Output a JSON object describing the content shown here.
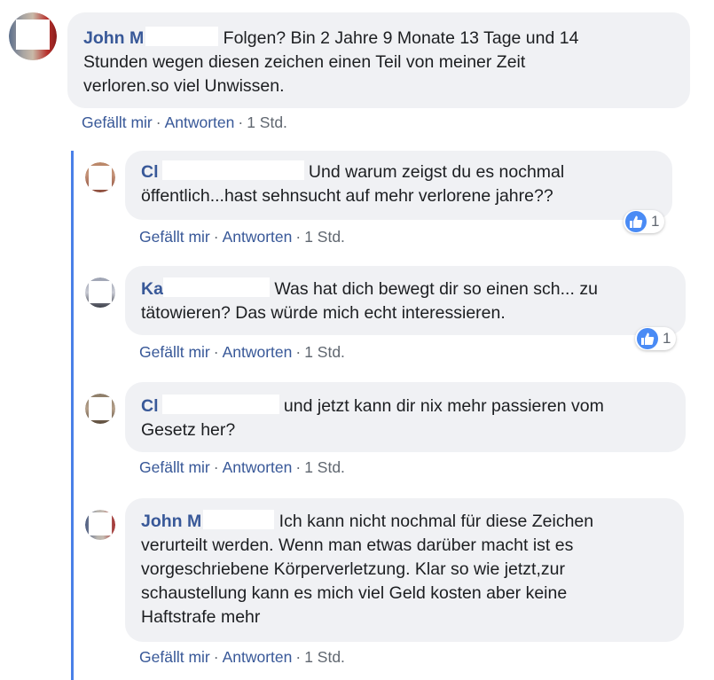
{
  "comments": [
    {
      "author": "John M",
      "text_line1": "Folgen? Bin 2 Jahre 9 Monate 13 Tage und 14",
      "text_lines": [
        "Stunden wegen diesen zeichen einen Teil von meiner Zeit",
        "verloren.so viel Unwissen."
      ],
      "like_label": "Gefällt mir",
      "reply_label": "Antworten",
      "time": "1 Std.",
      "separator": "·"
    }
  ],
  "replies": [
    {
      "author": "Cl",
      "text_line1": "Und warum zeigst du es nochmal",
      "text_lines": [
        "öffentlich...hast sehnsucht auf mehr verlorene jahre??"
      ],
      "like_label": "Gefällt mir",
      "reply_label": "Antworten",
      "time": "1 Std.",
      "reaction": {
        "icon": "like-icon",
        "count": "1"
      }
    },
    {
      "author": "Ka",
      "text_line1": "Was hat dich bewegt dir so einen sch... zu",
      "text_lines": [
        "tätowieren? Das würde mich echt interessieren."
      ],
      "like_label": "Gefällt mir",
      "reply_label": "Antworten",
      "time": "1 Std.",
      "reaction": {
        "icon": "like-icon",
        "count": "1"
      }
    },
    {
      "author": "Cl",
      "text_line1": "und jetzt kann dir nix mehr passieren vom",
      "text_lines": [
        "Gesetz her?"
      ],
      "like_label": "Gefällt mir",
      "reply_label": "Antworten",
      "time": "1 Std."
    },
    {
      "author": "John M",
      "text_line1": "Ich kann nicht nochmal für diese Zeichen",
      "text_lines": [
        "verurteilt werden. Wenn man etwas darüber macht ist es",
        "vorgeschriebene Körperverletzung. Klar so wie jetzt,zur",
        "schaustellung kann es mich viel Geld kosten aber keine",
        "Haftstrafe mehr"
      ],
      "like_label": "Gefällt mir",
      "reply_label": "Antworten",
      "time": "1 Std."
    }
  ],
  "separator": "·",
  "colors": {
    "link": "#385898",
    "bubble": "#f0f1f4",
    "thread_line": "#4a80e8",
    "like": "#4a8bf5"
  }
}
